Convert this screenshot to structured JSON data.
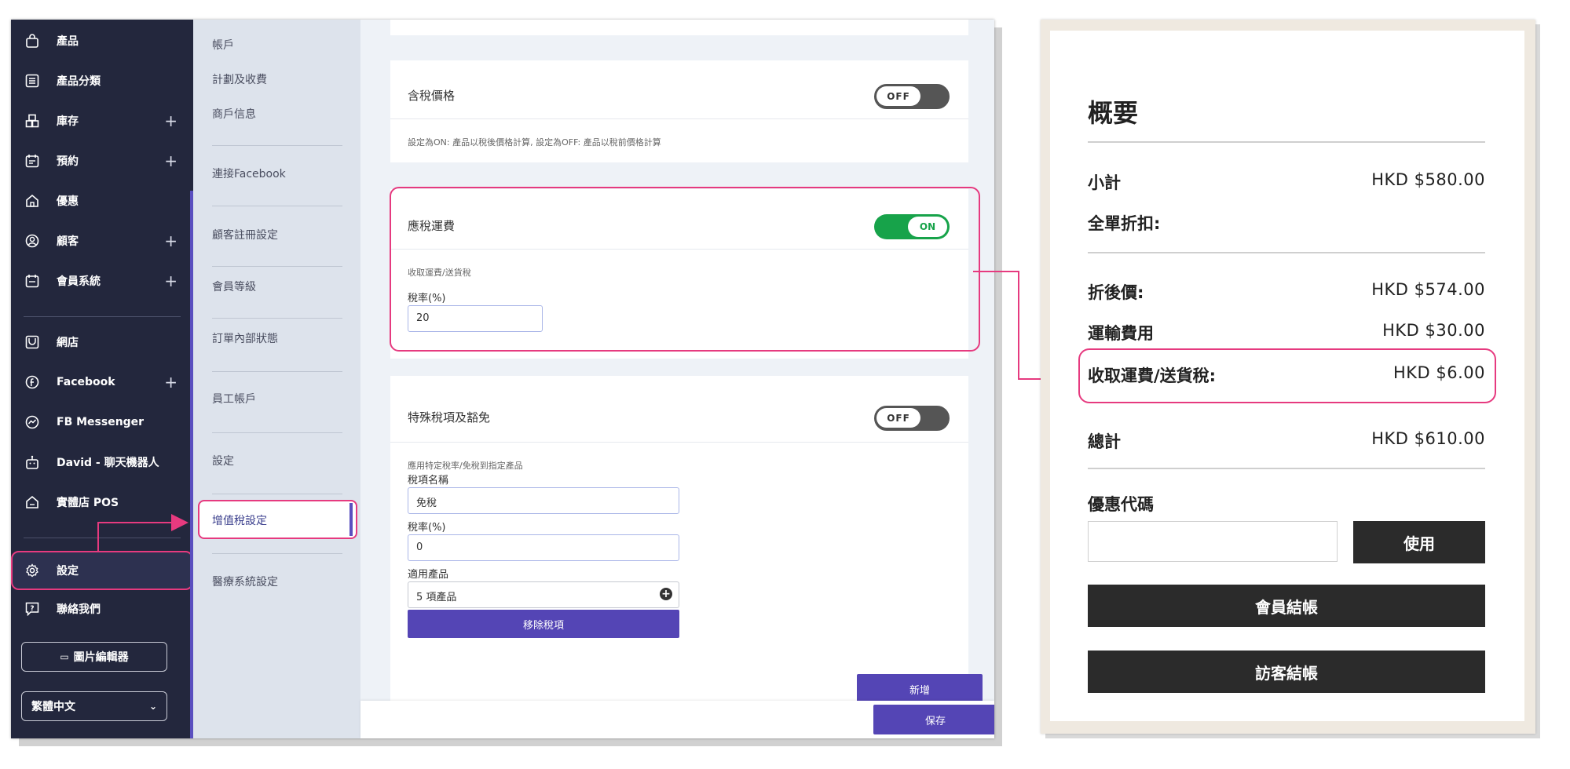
{
  "sidebar": {
    "items": [
      {
        "label": "產品",
        "icon": "shopping-bag-icon",
        "plus": ""
      },
      {
        "label": "產品分類",
        "icon": "list-icon",
        "plus": ""
      },
      {
        "label": "庫存",
        "icon": "boxes-icon",
        "plus": "+"
      },
      {
        "label": "預約",
        "icon": "calendar-icon",
        "plus": "+"
      },
      {
        "label": "優惠",
        "icon": "house-icon",
        "plus": ""
      },
      {
        "label": "顧客",
        "icon": "user-icon",
        "plus": "+"
      },
      {
        "label": "會員系統",
        "icon": "member-card-icon",
        "plus": "+"
      },
      {
        "label": "網店",
        "icon": "storefront-icon",
        "plus": ""
      },
      {
        "label": "Facebook",
        "icon": "facebook-icon",
        "plus": "+"
      },
      {
        "label": "FB Messenger",
        "icon": "messenger-icon",
        "plus": ""
      },
      {
        "label": "David - 聊天機器人",
        "icon": "robot-icon",
        "plus": ""
      },
      {
        "label": "實體店 POS",
        "icon": "store-icon",
        "plus": ""
      },
      {
        "label": "設定",
        "icon": "gear-icon",
        "plus": ""
      },
      {
        "label": "聯絡我們",
        "icon": "help-icon",
        "plus": ""
      }
    ],
    "image_editor": "圖片編輯器",
    "language": "繁體中文"
  },
  "subnav": {
    "items": [
      "帳戶",
      "計劃及收費",
      "商戶信息",
      "連接Facebook",
      "顧客註冊設定",
      "會員等級",
      "訂單內部狀態",
      "員工帳戶",
      "設定",
      "增值稅設定",
      "醫療系統設定"
    ]
  },
  "tax_inclusive": {
    "title": "含稅價格",
    "toggle": "OFF",
    "desc": "設定為ON: 產品以稅後價格計算, 設定為OFF: 產品以稅前價格計算"
  },
  "shipping_tax": {
    "title": "應稅運費",
    "toggle": "ON",
    "desc": "收取運費/送貨稅",
    "rate_label": "稅率(%)",
    "rate_value": "20"
  },
  "special_tax": {
    "title": "特殊稅項及豁免",
    "toggle": "OFF",
    "desc": "應用特定稅率/免稅到指定產品",
    "name_label": "稅項名稱",
    "name_value": "免稅",
    "rate_label": "稅率(%)",
    "rate_value": "0",
    "products_label": "適用產品",
    "products_value": "5 項產品",
    "remove_button": "移除稅項",
    "add_button": "新增"
  },
  "save_button": "保存",
  "summary": {
    "title": "概要",
    "subtotal_label": "小計",
    "subtotal_value": "HKD $580.00",
    "discount_label": "全單折扣:",
    "after_discount_label": "折後價:",
    "after_discount_value": "HKD $574.00",
    "shipping_label": "運輸費用",
    "shipping_value": "HKD $30.00",
    "shipping_tax_label": "收取運費/送貨稅:",
    "shipping_tax_value": "HKD $6.00",
    "total_label": "總計",
    "total_value": "HKD $610.00",
    "coupon_label": "優惠代碼",
    "apply_button": "使用",
    "member_checkout": "會員結帳",
    "guest_checkout": "訪客結帳"
  },
  "colors": {
    "highlight": "#e63a7f",
    "sidebar": "#23273d",
    "accent_purple": "#5445b5",
    "toggle_on": "#17a34a"
  }
}
